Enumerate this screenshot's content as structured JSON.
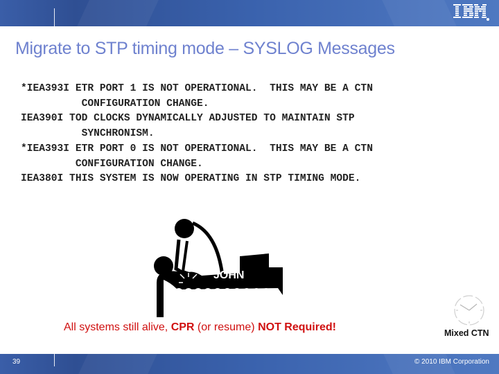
{
  "slide": {
    "title": "Migrate to STP timing mode – SYSLOG Messages",
    "logo": "IBM",
    "logo_icon": "ibm-logo-icon",
    "messages": [
      "*IEA393I ETR PORT 1 IS NOT OPERATIONAL.  THIS MAY BE A CTN",
      "          CONFIGURATION CHANGE.",
      "IEA390I TOD CLOCKS DYNAMICALLY ADJUSTED TO MAINTAIN STP",
      "          SYNCHRONISM.",
      "*IEA393I ETR PORT 0 IS NOT OPERATIONAL.  THIS MAY BE A CTN",
      "         CONFIGURATION CHANGE.",
      "IEA380I THIS SYSTEM IS NOW OPERATING IN STP TIMING MODE."
    ],
    "illustration": {
      "icon": "cpr-illustration-icon",
      "label": "JOHN"
    },
    "caption": {
      "part1": "All systems still alive, ",
      "part2": "CPR",
      "part3": " (or resume) ",
      "part4": "NOT Required!"
    },
    "clock": {
      "icon": "clock-icon",
      "label": "Mixed CTN"
    }
  },
  "footer": {
    "page_number": "39",
    "copyright": "© 2010 IBM Corporation"
  },
  "colors": {
    "title": "#6f82cf",
    "caption": "#d01010",
    "band": "#3a62ad"
  }
}
